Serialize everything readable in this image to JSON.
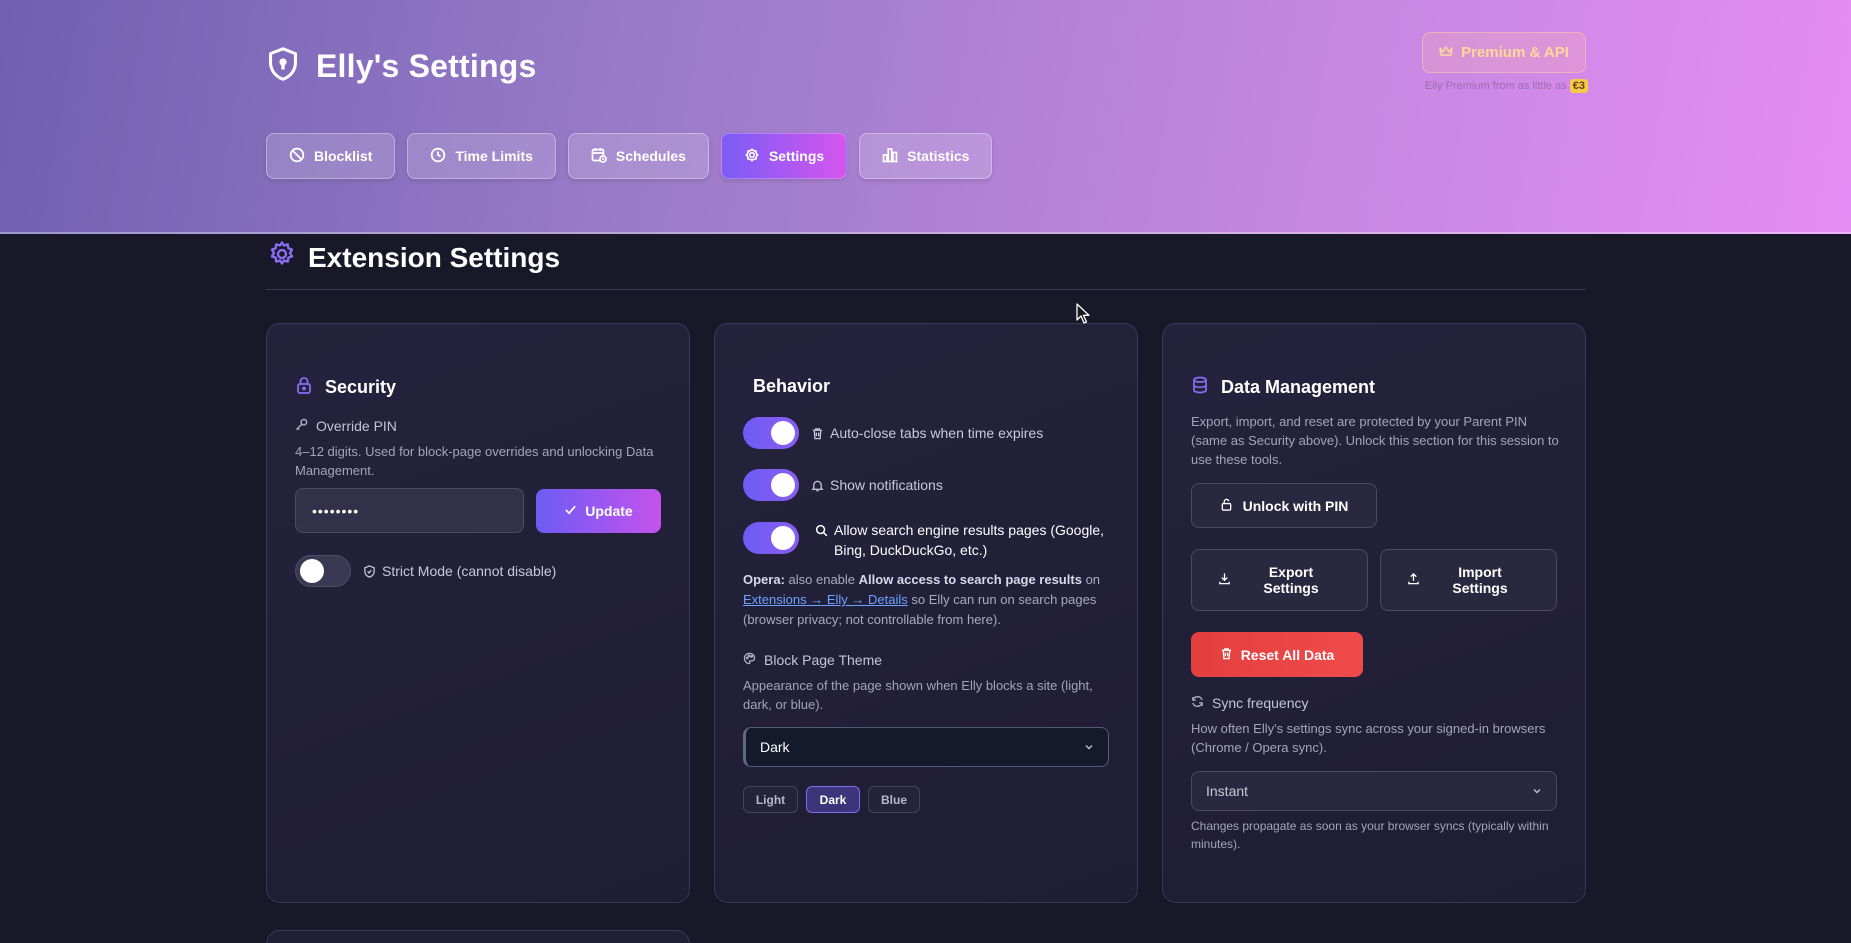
{
  "header": {
    "title": "Elly's Settings",
    "premium_button": "Premium & API",
    "premium_note_prefix": "Elly Premium from as little as",
    "premium_note_price": "€3"
  },
  "tabs": [
    {
      "label": "Blocklist",
      "icon": "block-icon"
    },
    {
      "label": "Time Limits",
      "icon": "clock-icon"
    },
    {
      "label": "Schedules",
      "icon": "calendar-icon"
    },
    {
      "label": "Settings",
      "icon": "gear-icon",
      "active": true
    },
    {
      "label": "Statistics",
      "icon": "bar-chart-icon"
    }
  ],
  "section": {
    "title": "Extension Settings"
  },
  "security": {
    "title": "Security",
    "pin_label": "Override PIN",
    "pin_help": "4–12 digits. Used for block-page overrides and unlocking Data Management.",
    "pin_value": "••••••••",
    "update_button": "Update",
    "strict_mode_label": "Strict Mode (cannot disable)",
    "strict_mode_on": false
  },
  "behavior": {
    "title": "Behavior",
    "auto_close_label": "Auto-close tabs when time expires",
    "notifications_label": "Show notifications",
    "search_label": "Allow search engine results pages (Google, Bing, DuckDuckGo, etc.)",
    "opera_bold": "Opera:",
    "opera_text1": "also enable",
    "opera_bold2": "Allow access to search page results",
    "opera_text2": "on",
    "opera_link": "Extensions → Elly → Details",
    "opera_text3": "so Elly can run on search pages (browser privacy; not controllable from here).",
    "theme_label": "Block Page Theme",
    "theme_help": "Appearance of the page shown when Elly blocks a site (light, dark, or blue).",
    "theme_selected": "Dark",
    "theme_chips": [
      "Light",
      "Dark",
      "Blue"
    ],
    "theme_active": "Dark"
  },
  "data_management": {
    "title": "Data Management",
    "help": "Export, import, and reset are protected by your Parent PIN (same as Security above). Unlock this section for this session to use these tools.",
    "unlock_button": "Unlock with PIN",
    "export_button": "Export Settings",
    "import_button": "Import Settings",
    "reset_button": "Reset All Data",
    "sync_label": "Sync frequency",
    "sync_help": "How often Elly's settings sync across your signed-in browsers (Chrome / Opera sync).",
    "sync_selected": "Instant",
    "sync_note": "Changes propagate as soon as your browser syncs (typically within minutes)."
  },
  "colors": {
    "accent": "#7b5cf6",
    "accent_pink": "#d455ee",
    "danger": "#e33f3f",
    "background": "#181829"
  }
}
